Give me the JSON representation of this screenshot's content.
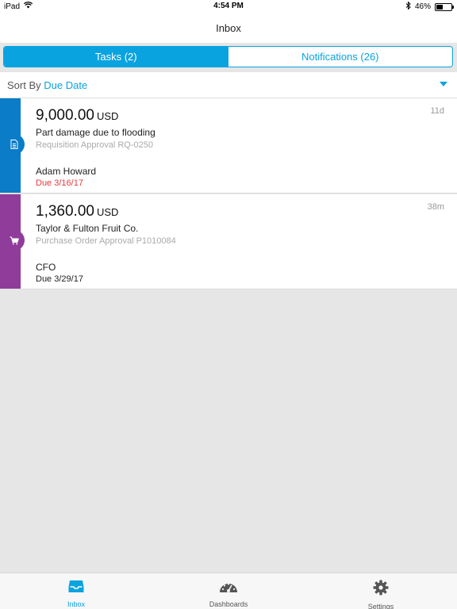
{
  "status_bar": {
    "device": "iPad",
    "time": "4:54 PM",
    "battery": "46%",
    "battery_level": 0.46
  },
  "nav": {
    "title": "Inbox"
  },
  "segments": [
    {
      "label": "Tasks (2)",
      "active": true
    },
    {
      "label": "Notifications (26)",
      "active": false
    }
  ],
  "sort": {
    "prefix": "Sort By",
    "value": "Due Date"
  },
  "tasks": [
    {
      "amount": "9,000.00",
      "currency": "USD",
      "age": "11d",
      "title": "Part damage due to flooding",
      "subtitle": "Requisition Approval RQ-0250",
      "person": "Adam Howard",
      "due": "Due 3/16/17",
      "icon": "document-icon",
      "color": "#0a7cc8",
      "overdue": true
    },
    {
      "amount": "1,360.00",
      "currency": "USD",
      "age": "38m",
      "title": "Taylor & Fulton Fruit Co.",
      "subtitle": "Purchase Order Approval P1010084",
      "person": "CFO",
      "due": "Due 3/29/17",
      "icon": "cart-icon",
      "color": "#8f3c9a",
      "overdue": false
    }
  ],
  "tab_bar": [
    {
      "label": "Inbox",
      "icon": "inbox-icon",
      "active": true
    },
    {
      "label": "Dashboards",
      "icon": "dashboard-icon",
      "active": false
    },
    {
      "label": "Settings",
      "icon": "settings-icon",
      "active": false
    }
  ],
  "colors": {
    "accent": "#09a3e0",
    "overdue": "#e8383d"
  }
}
